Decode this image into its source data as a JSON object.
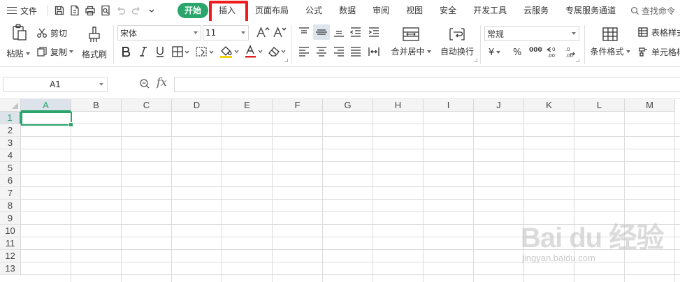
{
  "menubar": {
    "file_label": "文件",
    "tabs": [
      {
        "label": "开始",
        "active": true
      },
      {
        "label": "插入",
        "active": false
      },
      {
        "label": "页面布局",
        "active": false
      },
      {
        "label": "公式",
        "active": false
      },
      {
        "label": "数据",
        "active": false
      },
      {
        "label": "审阅",
        "active": false
      },
      {
        "label": "视图",
        "active": false
      },
      {
        "label": "安全",
        "active": false
      },
      {
        "label": "开发工具",
        "active": false
      },
      {
        "label": "云服务",
        "active": false
      },
      {
        "label": "专属服务通道",
        "active": false
      }
    ],
    "search_label": "查找命令"
  },
  "ribbon": {
    "paste_label": "粘贴",
    "cut_label": "剪切",
    "copy_label": "复制",
    "format_painter_label": "格式刷",
    "font_name": "宋体",
    "font_size": "11",
    "merge_center_label": "合并居中",
    "wrap_text_label": "自动换行",
    "number_format": "常规",
    "currency_symbol": "¥",
    "percent_symbol": "%",
    "thousands_symbol": "000",
    "conditional_format_label": "条件格式",
    "table_style_label": "表格样式",
    "cell_style_label": "单元格样式"
  },
  "formula_bar": {
    "name_box": "A1",
    "fx_label": "fx",
    "formula": ""
  },
  "sheet": {
    "columns": [
      "A",
      "B",
      "C",
      "D",
      "E",
      "F",
      "G",
      "H",
      "I",
      "J",
      "K",
      "L",
      "M"
    ],
    "rows": [
      "1",
      "2",
      "3",
      "4",
      "5",
      "6",
      "7",
      "8",
      "9",
      "10",
      "11",
      "12",
      "13"
    ],
    "selected_column": "A",
    "selected_row": "1"
  },
  "watermark": {
    "main": "Bai du 经验",
    "sub": "jingyan.baidu.com"
  },
  "colors": {
    "accent": "#2aa56c",
    "highlight_box": "#ee1c1c",
    "font_color_bar": "#e02020",
    "fill_color_bar": "#f5d40f"
  }
}
